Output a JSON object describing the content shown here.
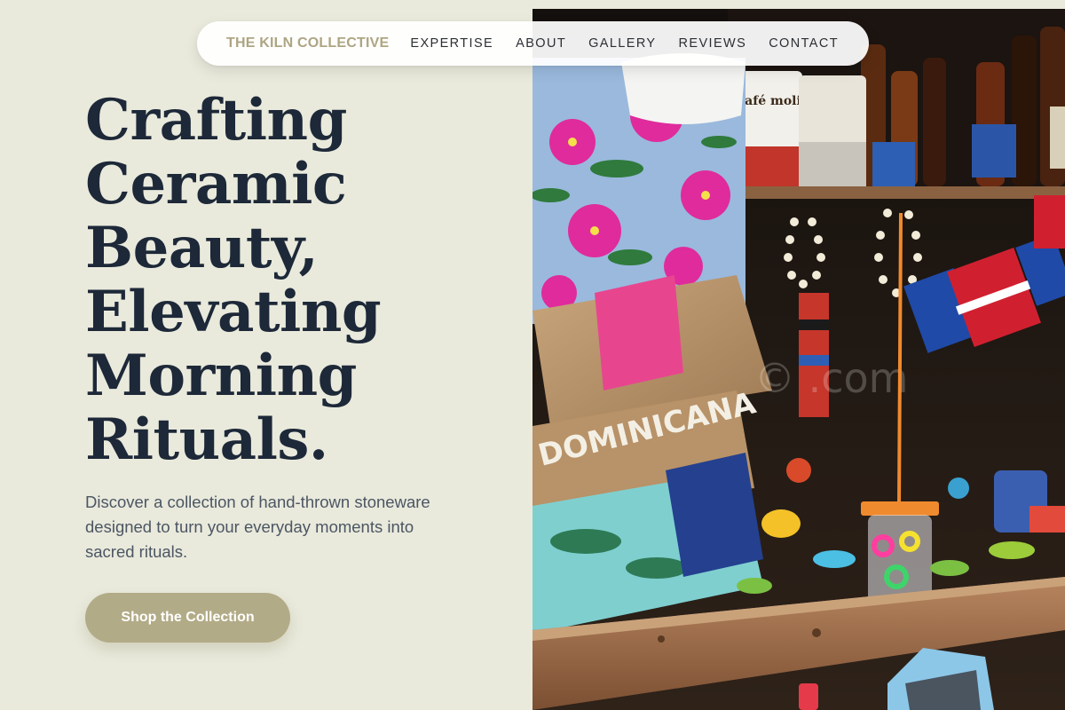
{
  "nav": {
    "brand": "THE KILN COLLECTIVE",
    "links": [
      "EXPERTISE",
      "ABOUT",
      "GALLERY",
      "REVIEWS",
      "CONTACT"
    ]
  },
  "hero": {
    "title_lines": [
      "Crafting",
      "Ceramic",
      "Beauty,",
      "Elevating",
      "Morning",
      "Rituals."
    ],
    "description": "Discover a collection of hand-thrown stoneware designed to turn your everyday moments into sacred rituals.",
    "cta_label": "Shop the Collection"
  },
  "photo": {
    "signage_text": "DOMINICANA",
    "watermark_text": "© .com",
    "packet_label": "Café molido"
  },
  "colors": {
    "background": "#e9eadc",
    "brand": "#ada582",
    "heading": "#1d2838",
    "body_text": "#4c5663",
    "button": "#b2ab87"
  }
}
